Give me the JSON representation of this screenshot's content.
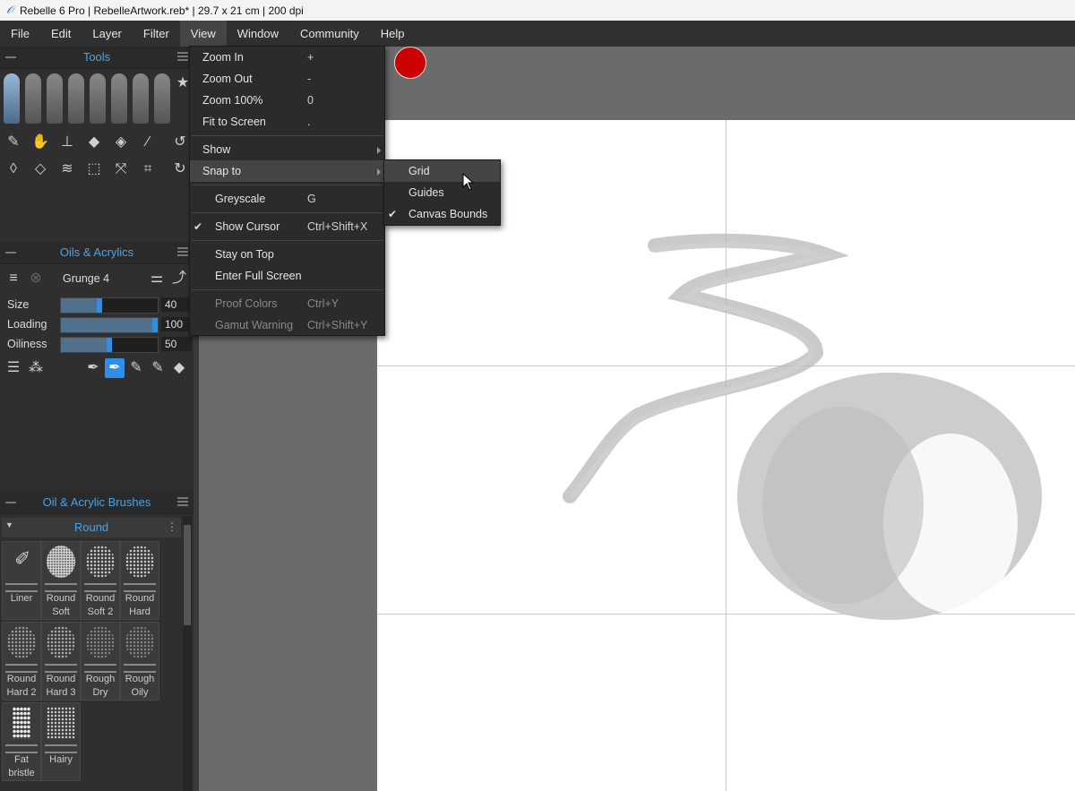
{
  "window": {
    "title": "Rebelle 6 Pro | RebelleArtwork.reb* | 29.7 x 21 cm | 200 dpi"
  },
  "menubar": [
    "File",
    "Edit",
    "Layer",
    "Filter",
    "View",
    "Window",
    "Community",
    "Help"
  ],
  "panels": {
    "tools": {
      "title": "Tools"
    },
    "oils": {
      "title": "Oils & Acrylics",
      "preset": "Grunge 4",
      "sliders": [
        {
          "label": "Size",
          "value": "40",
          "level": 0.4
        },
        {
          "label": "Loading",
          "value": "100",
          "level": 1.0
        },
        {
          "label": "Oiliness",
          "value": "50",
          "level": 0.5
        }
      ]
    },
    "brushes": {
      "title": "Oil & Acrylic Brushes",
      "category": "Round",
      "items": [
        "Liner",
        "Round Soft",
        "Round Soft 2",
        "Round Hard",
        "Round Hard 2",
        "Round Hard 3",
        "Rough Dry",
        "Rough Oily",
        "Fat bristle",
        "Hairy"
      ]
    }
  },
  "view_menu": {
    "items": [
      {
        "label": "Zoom In",
        "shortcut": "+"
      },
      {
        "label": "Zoom Out",
        "shortcut": "-"
      },
      {
        "label": "Zoom 100%",
        "shortcut": "0"
      },
      {
        "label": "Fit to Screen",
        "shortcut": "."
      },
      {
        "label": "Show",
        "shortcut": ""
      },
      {
        "label": "Snap to",
        "shortcut": ""
      },
      {
        "label": "Greyscale",
        "shortcut": "G"
      },
      {
        "label": "Show Cursor",
        "shortcut": "Ctrl+Shift+X"
      },
      {
        "label": "Stay on Top",
        "shortcut": ""
      },
      {
        "label": "Enter Full Screen",
        "shortcut": ""
      },
      {
        "label": "Proof Colors",
        "shortcut": "Ctrl+Y"
      },
      {
        "label": "Gamut Warning",
        "shortcut": "Ctrl+Shift+Y"
      }
    ]
  },
  "snap_submenu": {
    "items": [
      "Grid",
      "Guides",
      "Canvas Bounds"
    ]
  },
  "colors": {
    "accent": "#4aa3e8",
    "active_color": "#cc0000"
  }
}
